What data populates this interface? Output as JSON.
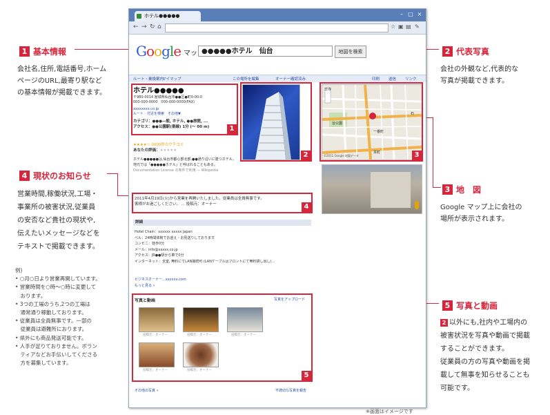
{
  "callouts": {
    "c1": {
      "num": "1",
      "title": "基本情報",
      "lines": [
        "会社名,住所,電話番号,ホーム",
        "ページのURL,最寄り駅など",
        "の基本情報が掲載できます。"
      ]
    },
    "c2": {
      "num": "2",
      "title": "代表写真",
      "lines": [
        "会社の外観など,代表的な",
        "写真が掲載できます。"
      ]
    },
    "c3": {
      "num": "3",
      "title": "地　図",
      "lines": [
        "Google マップ上に会社の",
        "場所が表示されます。"
      ]
    },
    "c4": {
      "num": "4",
      "title": "現状のお知らせ",
      "lines": [
        "営業時間,稼働状況,工場・",
        "事業所の被害状況,従業員",
        "の安否など貴社の現状や,",
        "伝えたいメッセージなどを",
        "テキストで掲載できます。"
      ]
    },
    "c4_examples": {
      "head": "例)",
      "items": [
        "• ○月○日より営業再開しています。",
        "• 営業時間を○時〜○時に変更して",
        "　おります。",
        "• 3つの工場のうち,2つの工場は",
        "　通常通り稼動しております。",
        "• 従業員は全員無事です。一部の",
        "　従業員は避難所におります。",
        "• 県外にも商品発送可能です。",
        "• 人手が足りておりません。ボラン",
        "　ティアなどお手伝いしてくださる",
        "　方を募集しています。"
      ]
    },
    "c5": {
      "num": "5",
      "title": "写真と動画",
      "badge": "2",
      "lines": [
        "以外にも,社内や工場内の",
        "被害状況を写真や動画で掲載",
        "することができます。",
        "従業員の方の写真や動画を掲",
        "載して無事を知らせることも",
        "可能です。"
      ]
    }
  },
  "footnote": "※画面はイメージです",
  "browser": {
    "tab_title": "ホテル●●●●●",
    "logo": {
      "G": "G",
      "o1": "o",
      "o2": "o",
      "g": "g",
      "l": "l",
      "e": "e",
      "suffix": "マップ"
    },
    "search_value": "●●●●●ホテル　仙台",
    "search_button": "地図を検索",
    "linkbar": {
      "left1": "ルート・乗換案内",
      "left2": "マイマップ",
      "mid1": "この場所を編集",
      "mid2": "オーナー確認済み",
      "r1": "印刷",
      "r2": "送信",
      "r3": "リンク"
    },
    "place": {
      "name": "ホテル●●●●●",
      "addr": "〒980-0014 宮城県仙台市●●区●町0-00-0",
      "phone": "000-000-0000　000-000-0000(FAX)",
      "url": "xxxxxxxx.co.jp",
      "links": "ルート　付近を検索　その他▼",
      "category": "カテゴリ：●●●—般, ホテル, ●●旅館, ...",
      "access": "アクセス：●●公園駅(東線) 1分 (〜 00 m)",
      "rating": "★★★★☆ 0000件のクチコミ",
      "your_rating": "あなたの評価：",
      "desc1": "ホテル●●●●●は,仙台市都心部北部,●●通り沿いに建つホテル。",
      "desc2": "地元では「●●●●●ホテル」と呼ばれることもある。",
      "desc3": "Documentation License の条件で利用 — Wikipedia",
      "notice1": "2011年4月19日(火)から営業を再開いたしました。従業員は全員無事です。",
      "notice2": "客様がお過ごしください。 ... 投稿元：オーナー"
    },
    "details": {
      "header": "詳細",
      "lines": [
        "Hotel Chain：xxxxxx xxxxx Japan",
        "ベル：24時間体制でお迎え・お見送りしております",
        "コンビニ：徒歩0分",
        "メール：info@xxxxx.co.jp",
        "アクセス：JR●●駅から車で0分",
        "インターネット：全室, 無料にてLAN接続可 (LANケーブルはフロントにて無料貸し出し)..."
      ],
      "more1": "ビジネスオーナー...xxxxxx.com",
      "more2": "もっと見る »"
    },
    "photos": {
      "header": "写真と動画",
      "upload": "写真をアップロード",
      "caption": "投稿元：オーナー",
      "footer_left": "その他の写真 »",
      "footer_right": "不適切な写真を報告"
    },
    "map_labels": {
      "l1": "日寺",
      "l2": "石",
      "l3": "台公園",
      "l4": "一番町",
      "l5": "本町",
      "copy": "©2011 Google 地図データ"
    }
  },
  "colors": {
    "accent": "#d6263c",
    "link": "#2a4dab",
    "browser_chrome": "#5a7fb8"
  }
}
